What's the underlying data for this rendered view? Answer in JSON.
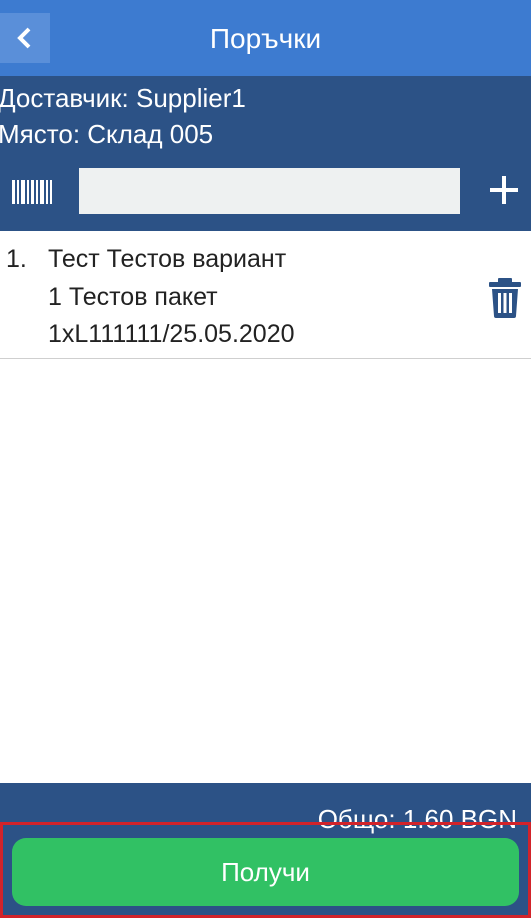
{
  "header": {
    "title": "Поръчки"
  },
  "info": {
    "supplier": "Доставчик: Supplier1",
    "location": "Място: Склад 005"
  },
  "scan": {
    "value": "",
    "placeholder": ""
  },
  "items": [
    {
      "index": "1.",
      "name": "Тест Тестов вариант",
      "package": "1 Тестов пакет",
      "lot": "1xL111111/25.05.2020"
    }
  ],
  "footer": {
    "total": "Общо: 1.60 BGN",
    "receive_label": "Получи"
  },
  "colors": {
    "header": "#3d7bd0",
    "panel": "#2c5286",
    "accent_green": "#31c164",
    "highlight": "#d2232a"
  },
  "icons": [
    "back-arrow-icon",
    "barcode-icon",
    "plus-icon",
    "trash-icon"
  ]
}
